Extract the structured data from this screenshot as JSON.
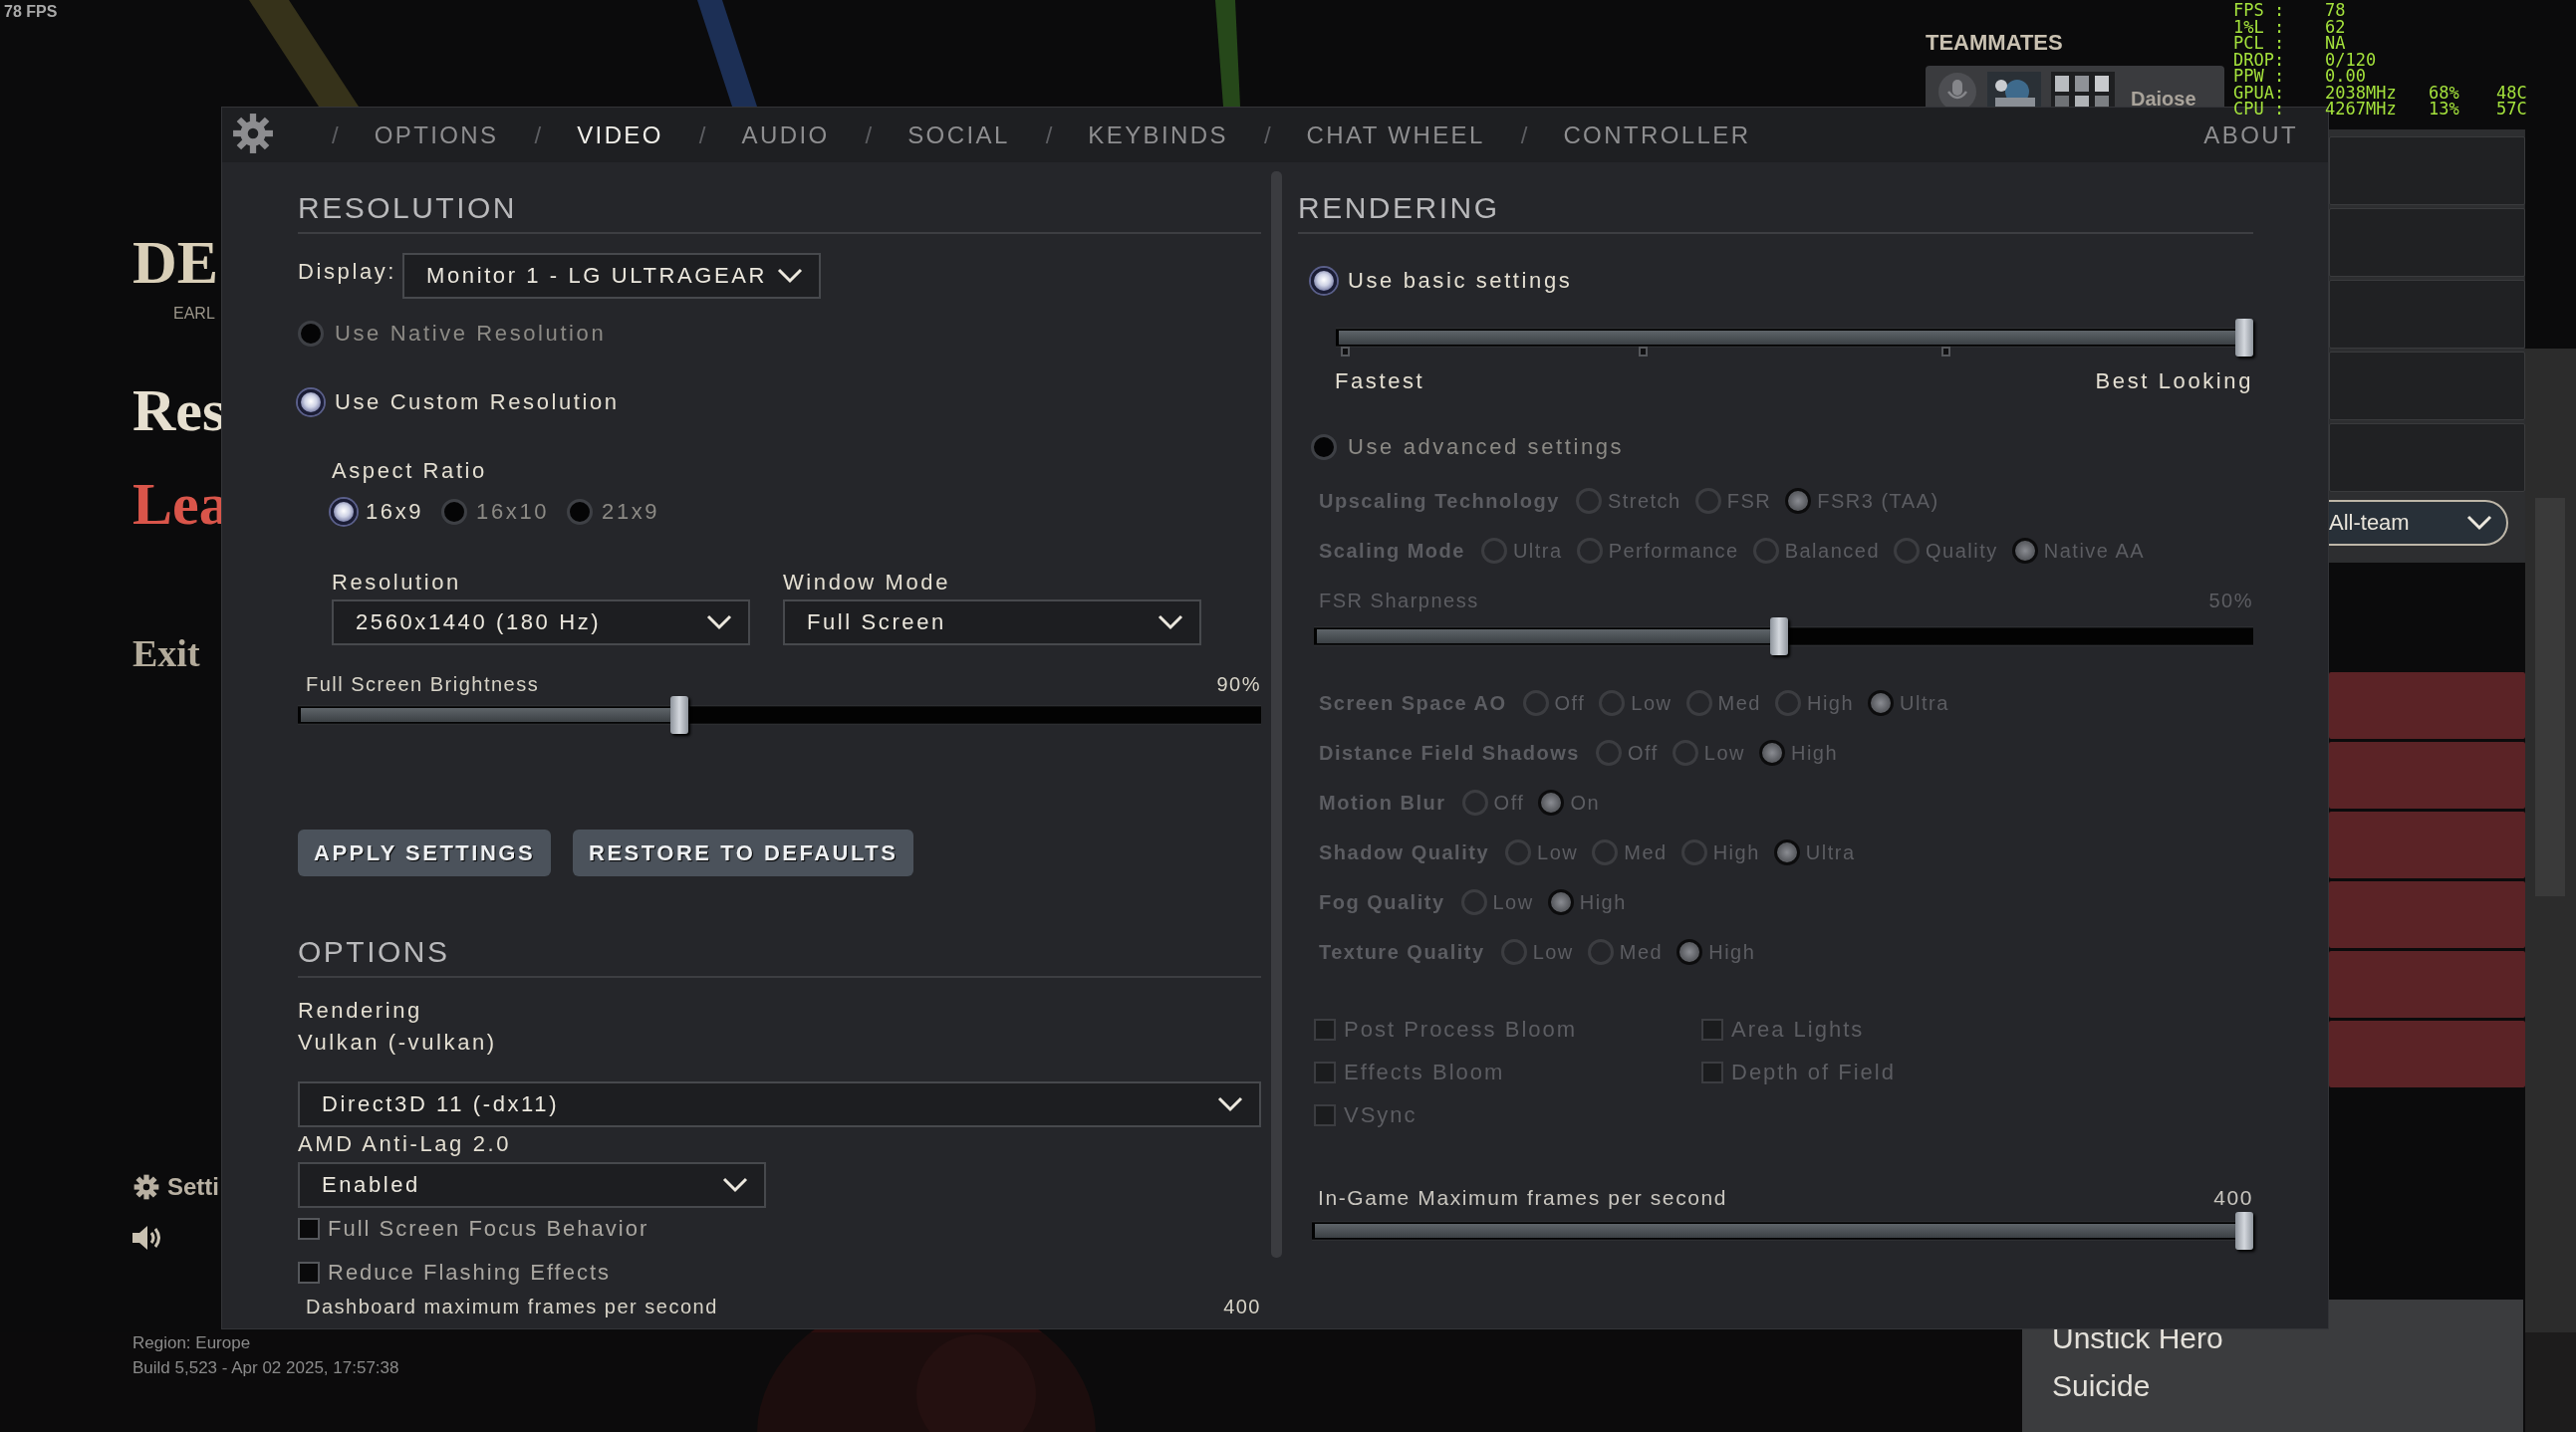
{
  "fps_counter": "78 FPS",
  "background_menu": {
    "logo": "DE",
    "logo_sub": "EARL",
    "items": [
      {
        "label": "Res",
        "kind": "main"
      },
      {
        "label": "Lea",
        "kind": "danger"
      },
      {
        "label": "Exit",
        "kind": "minor"
      }
    ],
    "settings_label": "Setti"
  },
  "build_info": [
    "Region: Europe",
    "Build 5,523 - Apr 02 2025, 17:57:38"
  ],
  "teammates": {
    "title": "TEAMMATES",
    "players": [
      {
        "name": "Daiose"
      }
    ]
  },
  "chat_mode": "All-team",
  "context_menu": [
    "Unstick Hero",
    "Suicide"
  ],
  "perf_overlay": [
    {
      "label": "FPS :",
      "values": [
        "78"
      ]
    },
    {
      "label": "1%L :",
      "values": [
        "62"
      ]
    },
    {
      "label": "PCL :",
      "values": [
        "NA"
      ]
    },
    {
      "label": "DROP:",
      "values": [
        "0/120"
      ]
    },
    {
      "label": "PPW :",
      "values": [
        "0.00"
      ]
    },
    {
      "label": "GPUA:",
      "values": [
        "2038MHz",
        "68%",
        "48C"
      ]
    },
    {
      "label": "CPU :",
      "values": [
        "4267MHz",
        "13%",
        "57C"
      ]
    }
  ],
  "settings": {
    "tabs": [
      {
        "separator": "/",
        "label": "OPTIONS",
        "selected": false
      },
      {
        "separator": "/",
        "label": "VIDEO",
        "selected": true
      },
      {
        "separator": "/",
        "label": "AUDIO",
        "selected": false
      },
      {
        "separator": "/",
        "label": "SOCIAL",
        "selected": false
      },
      {
        "separator": "/",
        "label": "KEYBINDS",
        "selected": false
      },
      {
        "separator": "/",
        "label": "CHAT WHEEL",
        "selected": false
      },
      {
        "separator": "/",
        "label": "CONTROLLER",
        "selected": false
      },
      {
        "label": "ABOUT",
        "selected": false
      }
    ],
    "resolution": {
      "title": "RESOLUTION",
      "display_label": "Display:",
      "display_value": "Monitor 1 - LG ULTRAGEAR",
      "modes": [
        {
          "label": "Use Native Resolution",
          "selected": false
        },
        {
          "label": "Use Custom Resolution",
          "selected": true
        }
      ],
      "aspect_label": "Aspect Ratio",
      "aspects": [
        {
          "label": "16x9",
          "selected": true
        },
        {
          "label": "16x10",
          "selected": false
        },
        {
          "label": "21x9",
          "selected": false
        }
      ],
      "resolution_label": "Resolution",
      "resolution_value": "2560x1440 (180 Hz)",
      "window_mode_label": "Window Mode",
      "window_mode_value": "Full Screen",
      "brightness": {
        "label": "Full Screen Brightness",
        "reading": "90%",
        "level": 0.4
      }
    },
    "buttons": [
      "APPLY SETTINGS",
      "RESTORE TO DEFAULTS"
    ],
    "options": {
      "title": "OPTIONS",
      "rendering_label": "Rendering",
      "rendering_current": "Vulkan (-vulkan)",
      "renderer_value": "Direct3D 11 (-dx11)",
      "antilag_label": "AMD Anti-Lag 2.0",
      "antilag_value": "Enabled",
      "checkboxes": [
        {
          "label": "Full Screen Focus Behavior",
          "checked": false
        },
        {
          "label": "Reduce Flashing Effects",
          "checked": false
        }
      ],
      "dashboard_fps": {
        "label": "Dashboard maximum frames per second",
        "reading": "400"
      }
    },
    "rendering": {
      "title": "RENDERING",
      "basic": {
        "label": "Use basic settings",
        "selected": true
      },
      "quality": {
        "level": 1,
        "min_label": "Fastest",
        "max_label": "Best Looking"
      },
      "advanced": {
        "label": "Use advanced settings",
        "selected": false
      },
      "advanced_disabled": true,
      "rows": [
        {
          "kind": "radio",
          "label": "Upscaling Technology",
          "choices": [
            {
              "label": "Stretch",
              "selected": false
            },
            {
              "label": "FSR",
              "selected": false
            },
            {
              "label": "FSR3 (TAA)",
              "selected": true
            }
          ]
        },
        {
          "kind": "radio",
          "label": "Scaling Mode",
          "choices": [
            {
              "label": "Ultra",
              "selected": false
            },
            {
              "label": "Performance",
              "selected": false
            },
            {
              "label": "Balanced",
              "selected": false
            },
            {
              "label": "Quality",
              "selected": false
            },
            {
              "label": "Native AA",
              "selected": true
            }
          ]
        },
        {
          "kind": "slider",
          "label": "FSR Sharpness",
          "reading": "50%",
          "level": 0.5
        },
        {
          "kind": "radio",
          "label": "Screen Space AO",
          "choices": [
            {
              "label": "Off",
              "selected": false
            },
            {
              "label": "Low",
              "selected": false
            },
            {
              "label": "Med",
              "selected": false
            },
            {
              "label": "High",
              "selected": false
            },
            {
              "label": "Ultra",
              "selected": true
            }
          ]
        },
        {
          "kind": "radio",
          "label": "Distance Field Shadows",
          "choices": [
            {
              "label": "Off",
              "selected": false
            },
            {
              "label": "Low",
              "selected": false
            },
            {
              "label": "High",
              "selected": true
            }
          ]
        },
        {
          "kind": "radio",
          "label": "Motion Blur",
          "choices": [
            {
              "label": "Off",
              "selected": false
            },
            {
              "label": "On",
              "selected": true
            }
          ]
        },
        {
          "kind": "radio",
          "label": "Shadow Quality",
          "choices": [
            {
              "label": "Low",
              "selected": false
            },
            {
              "label": "Med",
              "selected": false
            },
            {
              "label": "High",
              "selected": false
            },
            {
              "label": "Ultra",
              "selected": true
            }
          ]
        },
        {
          "kind": "radio",
          "label": "Fog Quality",
          "choices": [
            {
              "label": "Low",
              "selected": false
            },
            {
              "label": "High",
              "selected": true
            }
          ]
        },
        {
          "kind": "radio",
          "label": "Texture Quality",
          "choices": [
            {
              "label": "Low",
              "selected": false
            },
            {
              "label": "Med",
              "selected": false
            },
            {
              "label": "High",
              "selected": true
            }
          ]
        }
      ],
      "checkboxes": [
        {
          "label": "Post Process Bloom",
          "checked": false
        },
        {
          "label": "Area Lights",
          "checked": false
        },
        {
          "label": "Effects Bloom",
          "checked": false
        },
        {
          "label": "Depth of Field",
          "checked": false
        },
        {
          "label": "VSync",
          "checked": false
        }
      ],
      "max_fps": {
        "label": "In-Game Maximum frames per second",
        "reading": "400",
        "level": 1
      }
    }
  }
}
